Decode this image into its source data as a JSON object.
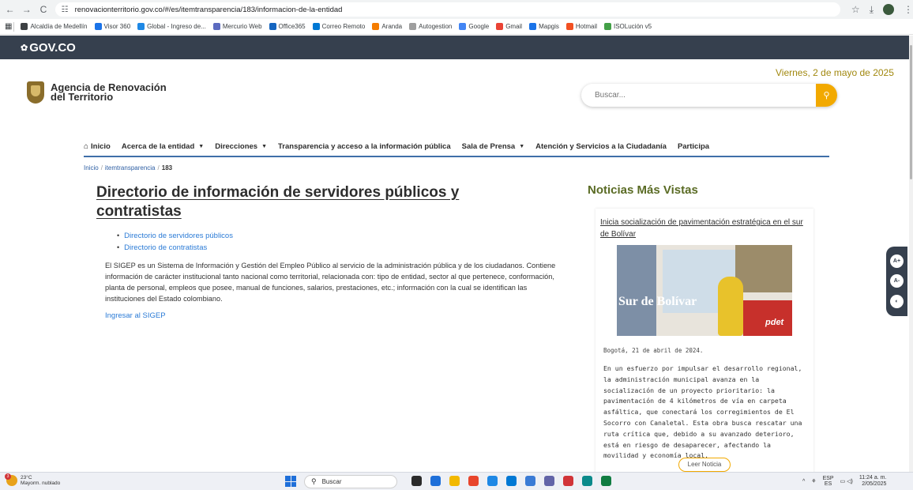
{
  "browser": {
    "url": "renovacionterritorio.gov.co/#/es/itemtransparencia/183/informacion-de-la-entidad",
    "bookmarks": [
      {
        "label": "Alcaldía de Medellín",
        "color": "#3c4043"
      },
      {
        "label": "Visor 360",
        "color": "#1a73e8"
      },
      {
        "label": "Global - Ingreso de...",
        "color": "#1e88e5"
      },
      {
        "label": "Mercurio Web",
        "color": "#5c6bc0"
      },
      {
        "label": "Office365",
        "color": "#1565c0"
      },
      {
        "label": "Correo Remoto",
        "color": "#0078d4"
      },
      {
        "label": "Aranda",
        "color": "#f57c00"
      },
      {
        "label": "Autogestion",
        "color": "#9e9e9e"
      },
      {
        "label": "Google",
        "color": "#4285f4"
      },
      {
        "label": "Gmail",
        "color": "#ea4335"
      },
      {
        "label": "Mapgis",
        "color": "#1a73e8"
      },
      {
        "label": "Hotmail",
        "color": "#f25022"
      },
      {
        "label": "ISOLución v5",
        "color": "#43a047"
      }
    ]
  },
  "govbar": {
    "brand": "GOV.CO"
  },
  "header": {
    "logo_line1": "Agencia de Renovación",
    "logo_line2": "del Territorio",
    "date": "Viernes, 2 de mayo de 2025",
    "search_placeholder": "Buscar..."
  },
  "nav": {
    "items": [
      {
        "label": "Inicio",
        "dropdown": false
      },
      {
        "label": "Acerca de la entidad",
        "dropdown": true
      },
      {
        "label": "Direcciones",
        "dropdown": true
      },
      {
        "label": "Transparencia y acceso a la información pública",
        "dropdown": false
      },
      {
        "label": "Sala de Prensa",
        "dropdown": true
      },
      {
        "label": "Atención y Servicios a la Ciudadanía",
        "dropdown": false
      },
      {
        "label": "Participa",
        "dropdown": false
      }
    ]
  },
  "breadcrumb": {
    "home": "Inicio",
    "section": "itemtransparencia",
    "current": "183"
  },
  "main": {
    "title": "Directorio de información de servidores públicos y contratistas",
    "links": [
      "Directorio de servidores públicos",
      "Directorio de contratistas"
    ],
    "intro": "El SIGEP es un Sistema de Información y Gestión del Empleo Público al servicio de la administración pública y de los ciudadanos. Contiene información de carácter institucional tanto nacional como territorial, relacionada con: tipo de entidad, sector al que pertenece, conformación, planta de personal, empleos que posee, manual de funciones, salarios, prestaciones, etc.; información con la cual se identifican las instituciones del Estado colombiano.",
    "sigep_link": "Ingresar al SIGEP"
  },
  "sidebar": {
    "heading": "Noticias Más Vistas",
    "news_title": "Inicia socialización de pavimentación estratégica en el sur de Bolívar",
    "image_text": "Sur de Bolívar",
    "image_brand": "pdet",
    "news_date": "Bogotá, 21 de abril de 2024.",
    "news_body": "En un esfuerzo por impulsar el desarrollo regional, la administración municipal avanza en la socialización de un proyecto prioritario: la pavimentación de 4 kilómetros de vía en carpeta asfáltica, que conectará los corregimientos de El Socorro con Canaletal. Esta obra busca rescatar una ruta crítica que, debido a su avanzado deterioro, está en riesgo de desaparecer, afectando la movilidad y economía local.",
    "read_button": "Leer Noticia"
  },
  "a11y": {
    "increase": "A+",
    "decrease": "A-",
    "contrast": "◐"
  },
  "taskbar": {
    "temp": "23°C",
    "weather": "Mayorm. nublado",
    "weather_badge": "3",
    "search": "Buscar",
    "lang1": "ESP",
    "lang2": "ES",
    "time": "11:24 a. m.",
    "date": "2/05/2025",
    "app_colors": [
      "#2b2b2b",
      "#1e6fd9",
      "#f2b800",
      "#e8452c",
      "#1e88e5",
      "#0078d4",
      "#3a7bd5",
      "#6264a7",
      "#d13438",
      "#0b8a8a",
      "#107c41"
    ]
  }
}
